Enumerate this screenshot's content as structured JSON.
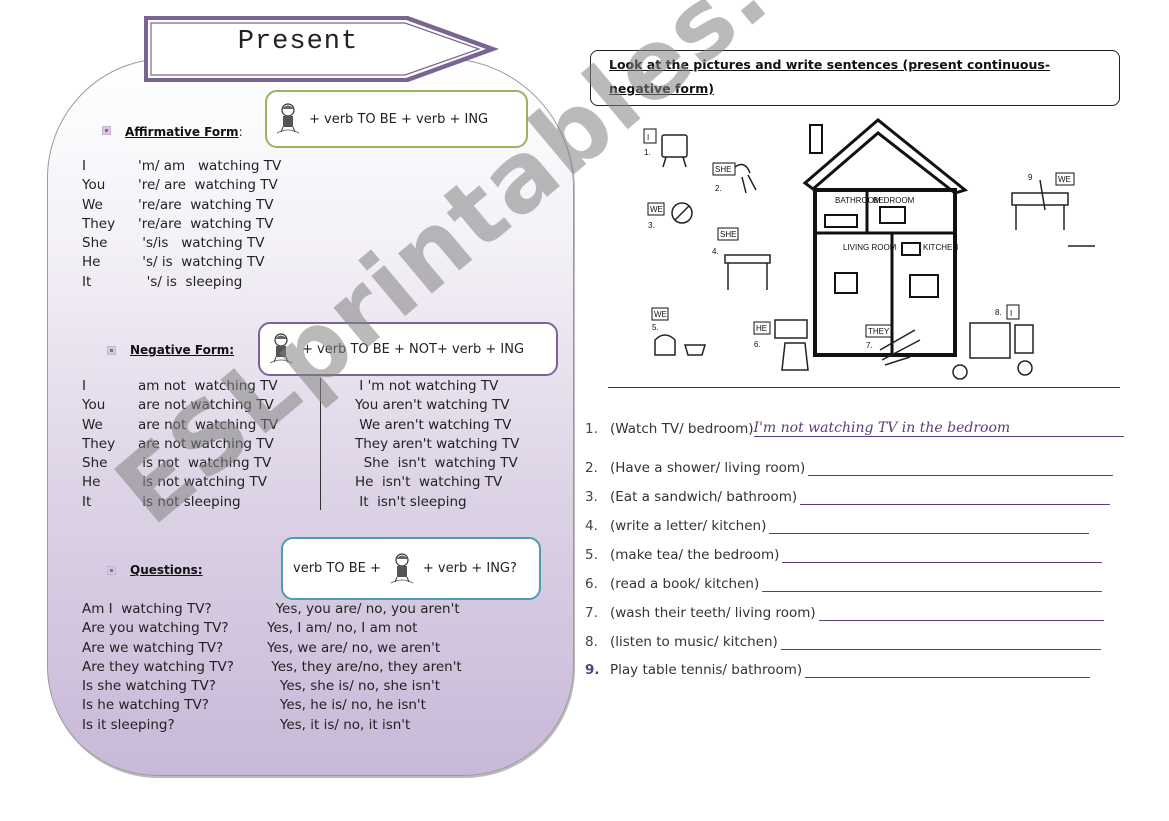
{
  "title": "Present",
  "watermark": "ESLprintables.com",
  "colors": {
    "panel_purple": "#c8b9d8",
    "banner_border": "#7a6592",
    "affirmative_box": "#9bb35e",
    "negative_box": "#7a6592",
    "questions_box": "#4e9bb3",
    "line_purple": "#5a3d7a"
  },
  "affirmative": {
    "label": "Affirmative Form",
    "label_suffix": ":",
    "formula": "+ verb TO BE + verb + ING",
    "rows": [
      {
        "subject": "I",
        "form": "'m/ am   watching TV"
      },
      {
        "subject": "You",
        "form": "'re/ are  watching TV"
      },
      {
        "subject": "We",
        "form": "'re/are  watching TV"
      },
      {
        "subject": "They",
        "form": "'re/are  watching TV"
      },
      {
        "subject": "She",
        "form": " 's/is   watching TV"
      },
      {
        "subject": "He",
        "form": " 's/ is  watching TV"
      },
      {
        "subject": "It",
        "form": "  's/ is  sleeping"
      }
    ]
  },
  "negative": {
    "label": "Negative Form:",
    "formula": "+ verb TO BE + NOT+ verb + ING",
    "full_rows": [
      {
        "subject": "I",
        "form": "am not  watching TV"
      },
      {
        "subject": "You",
        "form": "are not watching TV"
      },
      {
        "subject": "We",
        "form": "are not  watching TV"
      },
      {
        "subject": "They",
        "form": "are not watching TV"
      },
      {
        "subject": "She",
        "form": " is not  watching TV"
      },
      {
        "subject": "He",
        "form": " is not watching TV"
      },
      {
        "subject": "It",
        "form": " is not sleeping"
      }
    ],
    "short_rows": [
      " I 'm not watching TV",
      "You aren't watching TV",
      " We aren't watching TV",
      "They aren't watching TV",
      "  She  isn't  watching TV",
      "He  isn't  watching TV",
      " It  isn't sleeping"
    ]
  },
  "questions": {
    "label": "Questions:",
    "formula_before": "verb TO BE +",
    "formula_after": "+ verb + ING?",
    "rows": [
      {
        "q": "Am I  watching TV?",
        "a": "  Yes, you are/ no, you aren't"
      },
      {
        "q": "Are you watching TV?",
        "a": "Yes, I am/ no, I am not"
      },
      {
        "q": "Are we watching TV?",
        "a": "Yes, we are/ no, we aren't"
      },
      {
        "q": "Are they watching TV?",
        "a": " Yes, they are/no, they aren't"
      },
      {
        "q": "Is she watching TV?",
        "a": "   Yes, she is/ no, she isn't"
      },
      {
        "q": "Is he watching TV?",
        "a": "   Yes, he is/ no, he isn't"
      },
      {
        "q": "Is it sleeping?",
        "a": "   Yes, it is/ no, it isn't"
      }
    ]
  },
  "exercise": {
    "instruction": "Look at the pictures and write sentences (present continuous-negative form)",
    "instruction_line1": "Look at the pictures and write sentences (present continuous-",
    "instruction_line2": "negative form)",
    "picture_labels": {
      "rooms": [
        "BATHROOM",
        "BEDROOM",
        "LIVING ROOM",
        "KITCHEN"
      ],
      "tags": [
        {
          "num": "1.",
          "who": "I"
        },
        {
          "num": "2.",
          "who": "SHE"
        },
        {
          "num": "3.",
          "who": "WE"
        },
        {
          "num": "4.",
          "who": "SHE"
        },
        {
          "num": "5.",
          "who": "WE"
        },
        {
          "num": "6.",
          "who": "HE"
        },
        {
          "num": "7.",
          "who": "THEY"
        },
        {
          "num": "8.",
          "who": "I"
        },
        {
          "num": "9",
          "who": "WE"
        }
      ]
    },
    "items": [
      {
        "num": "1.",
        "prompt": "(Watch TV/ bedroom)",
        "answer": "I'm not watching TV in the bedroom"
      },
      {
        "num": "2.",
        "prompt": "(Have a shower/ living room)",
        "answer": ""
      },
      {
        "num": "3.",
        "prompt": "(Eat a sandwich/ bathroom)",
        "answer": ""
      },
      {
        "num": "4.",
        "prompt": "(write a letter/ kitchen)",
        "answer": ""
      },
      {
        "num": "5.",
        "prompt": "(make tea/ the bedroom)",
        "answer": ""
      },
      {
        "num": "6.",
        "prompt": "(read a book/ kitchen)",
        "answer": ""
      },
      {
        "num": "7.",
        "prompt": "(wash their teeth/ living room)",
        "answer": ""
      },
      {
        "num": "8.",
        "prompt": "(listen to music/ kitchen)",
        "answer": ""
      },
      {
        "num": "9.",
        "prompt": "Play table tennis/ bathroom)",
        "answer": ""
      }
    ]
  }
}
